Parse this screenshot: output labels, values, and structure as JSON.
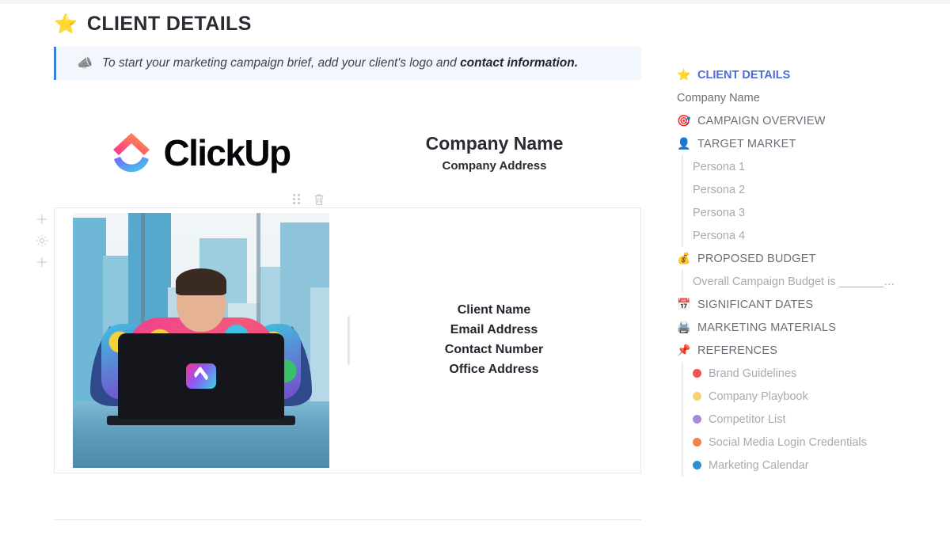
{
  "document": {
    "heading": {
      "emoji": "⭐",
      "text": "CLIENT DETAILS"
    },
    "callout": {
      "emoji": "📣",
      "text": "To start your marketing campaign brief, add your client's logo and ",
      "bold_text": "contact information."
    },
    "brand": {
      "logo_wordmark": "ClickUp",
      "company_name": "Company Name",
      "company_address": "Company Address"
    },
    "table": {
      "client_lines": [
        "Client Name",
        "Email Address",
        "Contact Number",
        "Office Address"
      ]
    }
  },
  "outline": {
    "items": [
      {
        "type": "section",
        "emoji": "⭐",
        "label": "CLIENT DETAILS",
        "active": true
      },
      {
        "type": "plain",
        "emoji": "",
        "label": "Company Name",
        "active": false
      },
      {
        "type": "section",
        "emoji": "🎯",
        "label": "CAMPAIGN OVERVIEW",
        "active": false
      },
      {
        "type": "section",
        "emoji": "👤",
        "label": "TARGET MARKET",
        "active": false
      },
      {
        "type": "sub",
        "label": "Persona 1"
      },
      {
        "type": "sub",
        "label": "Persona 2"
      },
      {
        "type": "sub",
        "label": "Persona 3"
      },
      {
        "type": "sub",
        "label": "Persona 4"
      },
      {
        "type": "section",
        "emoji": "💰",
        "label": "PROPOSED BUDGET",
        "active": false
      },
      {
        "type": "sub",
        "label": "Overall Campaign Budget is ________..."
      },
      {
        "type": "section",
        "emoji": "📅",
        "label": "SIGNIFICANT DATES",
        "active": false
      },
      {
        "type": "section",
        "emoji": "🖨️",
        "label": "MARKETING MATERIALS",
        "active": false
      },
      {
        "type": "section",
        "emoji": "📌",
        "label": "REFERENCES",
        "active": false
      },
      {
        "type": "sub",
        "label": "Brand Guidelines",
        "dot": "#ef5350"
      },
      {
        "type": "sub",
        "label": "Company Playbook",
        "dot": "#f8d568"
      },
      {
        "type": "sub",
        "label": "Competitor List",
        "dot": "#a78bda"
      },
      {
        "type": "sub",
        "label": "Social Media Login Credentials",
        "dot": "#f4843f"
      },
      {
        "type": "sub",
        "label": "Marketing Calendar",
        "dot": "#2f8fd0"
      }
    ]
  },
  "controls": {
    "drag_handle": "drag-handle-icon",
    "delete": "trash-icon",
    "add_above": "plus-icon",
    "settings": "gear-icon",
    "add_below": "plus-icon"
  },
  "colors": {
    "accent_blue": "#4b6bd8",
    "callout_bg": "#f2f6fd",
    "callout_border": "#3b7ddd",
    "heading_text": "#2b2b34"
  }
}
